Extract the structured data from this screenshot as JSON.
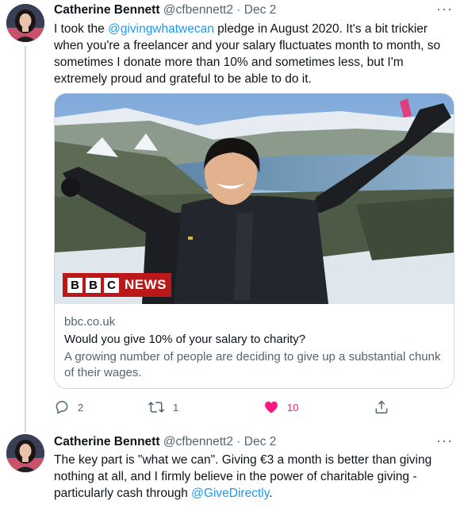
{
  "tweets": [
    {
      "author_name": "Catherine Bennett",
      "handle": "@cfbennett2",
      "separator": "·",
      "date": "Dec 2",
      "more_label": "···",
      "text_before": "I took the ",
      "mention": "@givingwhatwecan",
      "text_after": " pledge in August 2020. It's a bit trickier when you're a freelancer and your salary fluctuates month to month, so sometimes I donate more than 10% and sometimes less, but I'm extremely proud and grateful to be able to do it.",
      "card": {
        "logo_letters": [
          "B",
          "B",
          "C"
        ],
        "logo_word": "NEWS",
        "domain": "bbc.co.uk",
        "title": "Would you give 10% of your salary to charity?",
        "description": "A growing number of people are deciding to give up a substantial chunk of their wages."
      },
      "actions": {
        "reply_count": "2",
        "retweet_count": "1",
        "like_count": "10",
        "liked": true
      }
    },
    {
      "author_name": "Catherine Bennett",
      "handle": "@cfbennett2",
      "separator": "·",
      "date": "Dec 2",
      "more_label": "···",
      "text_before": "The key part is \"what we can\". Giving €3 a month is better than giving nothing at all, and I firmly believe in the power of charitable giving - particularly cash through ",
      "mention": "@GiveDirectly",
      "text_after": "."
    }
  ],
  "icons": {
    "reply": "reply-icon",
    "retweet": "retweet-icon",
    "like": "heart-icon",
    "share": "share-icon"
  },
  "colors": {
    "link": "#1d9bf0",
    "like": "#f91880",
    "muted": "#536471",
    "bbc_red": "#bb1919"
  }
}
